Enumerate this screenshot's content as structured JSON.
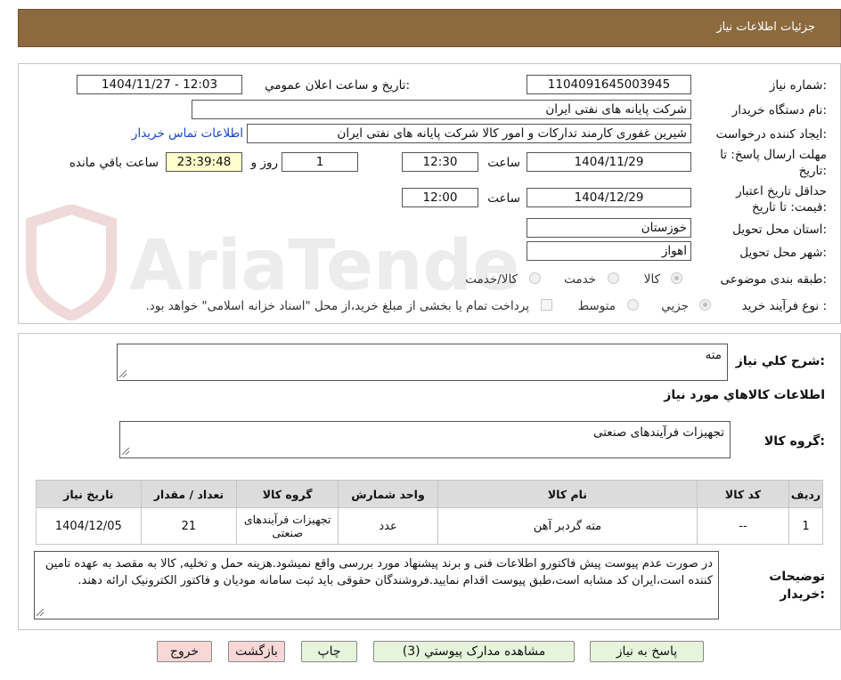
{
  "header": {
    "title": "جزئیات اطلاعات نیاز"
  },
  "watermark": {
    "text": "AriaTender.neT"
  },
  "form": {
    "need_number_label": "شماره نیاز:",
    "need_number": "1104091645003945",
    "announce_label": "تاریخ و ساعت اعلان عمومي:",
    "announce_value": "1404/11/27 - 12:03",
    "buyer_org_label": "نام دستگاه خریدار:",
    "buyer_org": "شرکت پایانه های نفتی ایران",
    "requester_label": "ایجاد کننده درخواست:",
    "requester": "شیرین غفوری کارمند تدارکات و امور کالا شرکت پایانه های نفتی ایران",
    "contact_link": "اطلاعات تماس خریدار",
    "deadline_label": "مهلت ارسال پاسخ: تا تاریخ:",
    "deadline_date": "1404/11/29",
    "time_label": "ساعت",
    "deadline_time": "12:30",
    "days_value": "1",
    "days_label": "روز و",
    "remaining_time": "23:39:48",
    "remaining_label": "ساعت باقي مانده",
    "validity_label": "حداقل تاریخ اعتبار قیمت: تا تاریخ:",
    "validity_date": "1404/12/29",
    "validity_time_label": "ساعت",
    "validity_time": "12:00",
    "province_label": "استان محل تحویل:",
    "province": "خوزستان",
    "city_label": "شهر محل تحویل:",
    "city": "اهواز",
    "category_label": "طبقه بندی موضوعی:",
    "category_options": [
      "کالا",
      "خدمت",
      "کالا/خدمت"
    ],
    "process_label": "نوع فرآیند خرید :",
    "process_options": [
      "جزیي",
      "متوسط"
    ],
    "process_note": "پرداخت تمام یا بخشی از مبلغ خرید،از محل \"اسناد خزانه اسلامی\" خواهد بود."
  },
  "details": {
    "summary_label": "شرح كلي نياز:",
    "summary": "مته",
    "goods_info_title": "اطلاعات کالاهاي مورد نياز",
    "goods_group_label": "گروه کالا:",
    "goods_group": "تجهیزات فرآیندهای صنعتی",
    "table": {
      "headers": [
        "رديف",
        "کد کالا",
        "نام کالا",
        "واحد شمارش",
        "گروه کالا",
        "تعداد / مقدار",
        "تاريخ نياز"
      ],
      "rows": [
        [
          "1",
          "--",
          "مته گردبر آهن",
          "عدد",
          "تجهیزات فرآیندهای صنعتی",
          "21",
          "1404/12/05"
        ]
      ]
    },
    "buyer_notes_label": "توضيحات خريدار:",
    "buyer_notes": "در صورت عدم پیوست پیش فاکتورو اطلاعات فنی  و برند پیشنهاد مورد بررسی واقع نمیشود.هزینه حمل و تخلیه, کالا به مقصد به عهده تامین کننده است،ایران کد مشابه است،طبق پیوست اقدام نمایید.فروشندگان حقوقی باید ثبت سامانه مودیان و فاکتور الکترونیک ارائه دهند."
  },
  "buttons": {
    "reply": "پاسخ به نياز",
    "attachments": "مشاهده مدارک پيوستي (3)",
    "print": "چاپ",
    "back": "بازگشت",
    "exit": "خروج"
  }
}
